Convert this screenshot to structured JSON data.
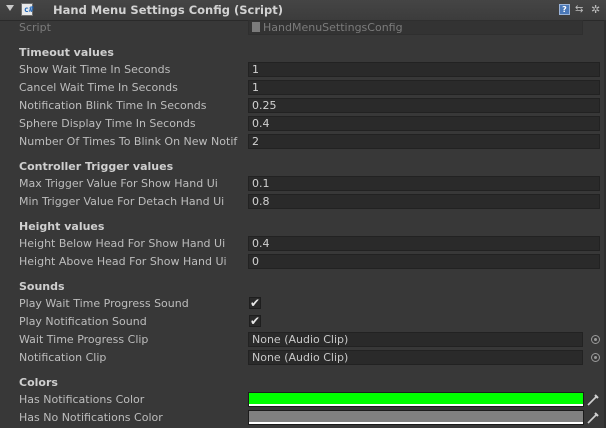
{
  "header": {
    "title": "Hand Menu Settings Config (Script)",
    "script_icon_glyph": "c#"
  },
  "script_row": {
    "label": "Script",
    "value": "HandMenuSettingsConfig"
  },
  "sections": {
    "timeout": {
      "heading": "Timeout values",
      "rows": [
        {
          "label": "Show Wait Time In Seconds",
          "value": "1"
        },
        {
          "label": "Cancel Wait Time In Seconds",
          "value": "1"
        },
        {
          "label": "Notification Blink Time In Seconds",
          "value": "0.25"
        },
        {
          "label": "Sphere Display Time In Seconds",
          "value": "0.4"
        },
        {
          "label": "Number Of Times To Blink On New Notif",
          "value": "2"
        }
      ]
    },
    "controller": {
      "heading": "Controller Trigger values",
      "rows": [
        {
          "label": "Max Trigger Value For Show Hand Ui",
          "value": "0.1"
        },
        {
          "label": "Min Trigger Value For Detach Hand Ui",
          "value": "0.8"
        }
      ]
    },
    "height": {
      "heading": "Height values",
      "rows": [
        {
          "label": "Height Below Head For Show Hand Ui",
          "value": "0.4"
        },
        {
          "label": "Height Above Head For Show Hand Ui",
          "value": "0"
        }
      ]
    },
    "sounds": {
      "heading": "Sounds",
      "toggles": [
        {
          "label": "Play Wait Time Progress Sound",
          "checked": true,
          "glyph": "✔"
        },
        {
          "label": "Play Notification Sound",
          "checked": true,
          "glyph": "✔"
        }
      ],
      "clips": [
        {
          "label": "Wait Time Progress Clip",
          "value": "None (Audio Clip)"
        },
        {
          "label": "Notification Clip",
          "value": "None (Audio Clip)"
        }
      ]
    },
    "colors": {
      "heading": "Colors",
      "rows": [
        {
          "label": "Has Notifications Color",
          "color": "#00ff00"
        },
        {
          "label": "Has No Notifications Color",
          "color": "#808080"
        }
      ]
    }
  },
  "icons": {
    "help": "?",
    "layout": "⇆",
    "gear": "✲"
  },
  "colors": {
    "background": "#383838",
    "field": "#2a2a2a",
    "text": "#bdbdbd"
  }
}
